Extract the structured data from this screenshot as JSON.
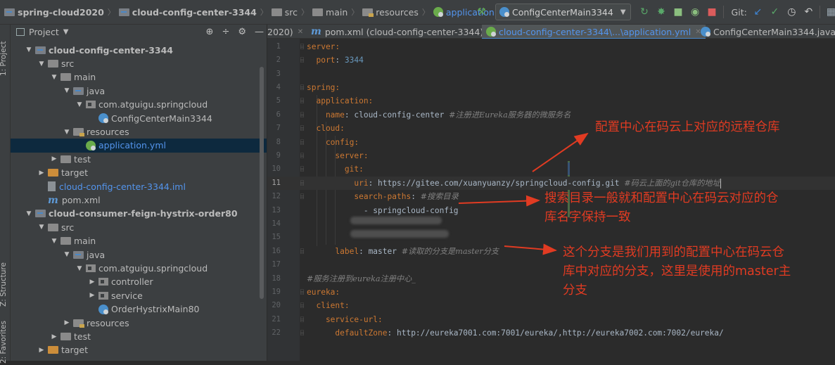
{
  "breadcrumbs": [
    {
      "label": "spring-cloud2020",
      "icon": "module-folder-icon"
    },
    {
      "label": "cloud-config-center-3344",
      "icon": "module-folder-icon"
    },
    {
      "label": "src",
      "icon": "folder-icon"
    },
    {
      "label": "main",
      "icon": "folder-icon"
    },
    {
      "label": "resources",
      "icon": "resources-folder-icon"
    },
    {
      "label": "application.yml",
      "icon": "yaml-file-icon"
    }
  ],
  "toolbar": {
    "run_config": "ConfigCenterMain3344",
    "git_label": "Git:",
    "icons": [
      "build-hammer-icon",
      "run-icon",
      "debug-icon",
      "coverage-icon",
      "profile-icon",
      "stop-icon",
      "git-update-icon",
      "git-commit-icon",
      "history-icon",
      "rollback-icon",
      "project-structure-icon"
    ]
  },
  "side_tabs": {
    "project": "1: Project",
    "structure": "Z: Structure",
    "favorites": "2: Favorites"
  },
  "project_panel": {
    "title": "Project",
    "tree": [
      {
        "label": "cloud-config-center-3344",
        "indent": 1,
        "expanded": true,
        "icon": "module",
        "style": "bold"
      },
      {
        "label": "src",
        "indent": 2,
        "expanded": true,
        "icon": "folder"
      },
      {
        "label": "main",
        "indent": 3,
        "expanded": true,
        "icon": "folder"
      },
      {
        "label": "java",
        "indent": 4,
        "expanded": true,
        "icon": "source-folder"
      },
      {
        "label": "com.atguigu.springcloud",
        "indent": 5,
        "expanded": true,
        "icon": "package"
      },
      {
        "label": "ConfigCenterMain3344",
        "indent": 6,
        "icon": "class"
      },
      {
        "label": "resources",
        "indent": 4,
        "expanded": true,
        "icon": "resources"
      },
      {
        "label": "application.yml",
        "indent": 5,
        "icon": "yaml",
        "style": "blue",
        "selected": true
      },
      {
        "label": "test",
        "indent": 3,
        "expanded": false,
        "icon": "folder"
      },
      {
        "label": "target",
        "indent": 2,
        "expanded": false,
        "icon": "target"
      },
      {
        "label": "cloud-config-center-3344.iml",
        "indent": 2,
        "icon": "iml",
        "style": "blue"
      },
      {
        "label": "pom.xml",
        "indent": 2,
        "icon": "maven"
      },
      {
        "label": "cloud-consumer-feign-hystrix-order80",
        "indent": 1,
        "expanded": true,
        "icon": "module",
        "style": "bold"
      },
      {
        "label": "src",
        "indent": 2,
        "expanded": true,
        "icon": "folder"
      },
      {
        "label": "main",
        "indent": 3,
        "expanded": true,
        "icon": "folder"
      },
      {
        "label": "java",
        "indent": 4,
        "expanded": true,
        "icon": "source-folder"
      },
      {
        "label": "com.atguigu.springcloud",
        "indent": 5,
        "expanded": true,
        "icon": "package"
      },
      {
        "label": "controller",
        "indent": 6,
        "expanded": false,
        "icon": "package"
      },
      {
        "label": "service",
        "indent": 6,
        "expanded": false,
        "icon": "package"
      },
      {
        "label": "OrderHystrixMain80",
        "indent": 6,
        "icon": "class"
      },
      {
        "label": "resources",
        "indent": 4,
        "expanded": false,
        "icon": "resources"
      },
      {
        "label": "test",
        "indent": 3,
        "expanded": false,
        "icon": "folder"
      },
      {
        "label": "target",
        "indent": 2,
        "expanded": false,
        "icon": "target"
      }
    ]
  },
  "editor_tabs": [
    {
      "label": "2020)",
      "icon": "",
      "closable": true,
      "active": false
    },
    {
      "label": "pom.xml (cloud-config-center-3344)",
      "icon": "maven",
      "closable": true,
      "active": false
    },
    {
      "label": "cloud-config-center-3344\\...\\application.yml",
      "icon": "yaml",
      "closable": true,
      "active": true
    },
    {
      "label": "ConfigCenterMain3344.java",
      "icon": "class",
      "closable": true,
      "active": false
    }
  ],
  "code": [
    {
      "no": "1",
      "parts": [
        [
          "k",
          "server:"
        ]
      ]
    },
    {
      "no": "2",
      "parts": [
        [
          "k",
          "  port"
        ],
        [
          "v",
          ": "
        ],
        [
          "n",
          "3344"
        ]
      ]
    },
    {
      "no": "3",
      "parts": []
    },
    {
      "no": "4",
      "parts": [
        [
          "k",
          "spring:"
        ]
      ]
    },
    {
      "no": "5",
      "parts": [
        [
          "k",
          "  application:"
        ]
      ]
    },
    {
      "no": "6",
      "parts": [
        [
          "k",
          "    name"
        ],
        [
          "v",
          ": cloud-config-center "
        ],
        [
          "c",
          "#注册进Eureka服务器的微服务名"
        ]
      ]
    },
    {
      "no": "7",
      "parts": [
        [
          "k",
          "  cloud:"
        ]
      ]
    },
    {
      "no": "8",
      "parts": [
        [
          "k",
          "    config:"
        ]
      ]
    },
    {
      "no": "9",
      "parts": [
        [
          "k",
          "      server:"
        ]
      ]
    },
    {
      "no": "10",
      "parts": [
        [
          "k",
          "        git:"
        ]
      ]
    },
    {
      "no": "11",
      "parts": [
        [
          "k",
          "          uri"
        ],
        [
          "v",
          ": https://gitee.com/xuanyuanzy/springcloud-config.git "
        ],
        [
          "c",
          "#码云上面的git仓库的地址"
        ]
      ],
      "current": true
    },
    {
      "no": "12",
      "parts": [
        [
          "k",
          "          search-paths"
        ],
        [
          "v",
          ": "
        ],
        [
          "c",
          "#搜索目录"
        ]
      ]
    },
    {
      "no": "13",
      "parts": [
        [
          "v",
          "            - springcloud-config"
        ]
      ]
    },
    {
      "no": "14",
      "parts": []
    },
    {
      "no": "15",
      "parts": []
    },
    {
      "no": "16",
      "parts": [
        [
          "k",
          "      label"
        ],
        [
          "v",
          ": master "
        ],
        [
          "c",
          "#读取的分支是master分支"
        ]
      ]
    },
    {
      "no": "17",
      "parts": []
    },
    {
      "no": "18",
      "parts": [
        [
          "c",
          "#服务注册到eureka注册中心_"
        ]
      ]
    },
    {
      "no": "19",
      "parts": [
        [
          "k",
          "eureka:"
        ]
      ]
    },
    {
      "no": "20",
      "parts": [
        [
          "k",
          "  client:"
        ]
      ]
    },
    {
      "no": "21",
      "parts": [
        [
          "k",
          "    service-url:"
        ]
      ]
    },
    {
      "no": "22",
      "parts": [
        [
          "k",
          "      defaultZone"
        ],
        [
          "v",
          ": http://eureka7001.com:7001/eureka/,http://eureka7002.com:7002/eureka/"
        ]
      ]
    }
  ],
  "annotations": {
    "remote_repo": "配置中心在码云上对应的远程仓库",
    "search_line1": "搜索目录一般就和配置中心在码云对应的仓",
    "search_line2": "库名字保持一致",
    "branch_line1": "这个分支是我们用到的配置中心在码云仓",
    "branch_line2": "库中对应的分支，这里是使用的master主",
    "branch_line3": "分支"
  },
  "colors": {
    "annotation": "#e13b22",
    "keyword": "#cc7832",
    "comment": "#808080",
    "number": "#6897bb",
    "link": "#5394ec"
  }
}
